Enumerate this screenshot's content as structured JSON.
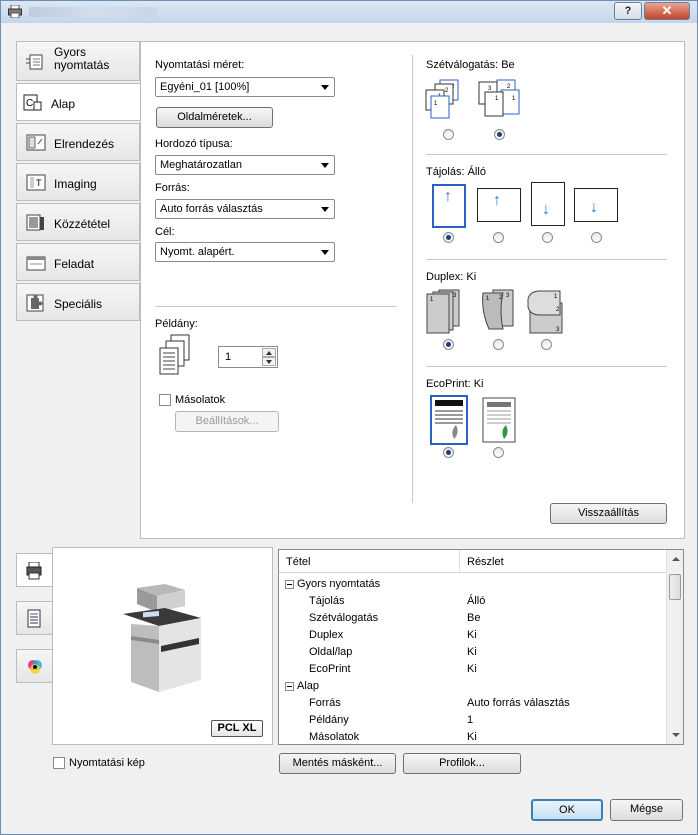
{
  "window": {
    "help": "?",
    "close": "✕"
  },
  "tabs": [
    {
      "label_line1": "Gyors",
      "label_line2": "nyomtatás"
    },
    {
      "label": "Alap"
    },
    {
      "label": "Elrendezés"
    },
    {
      "label": "Imaging"
    },
    {
      "label": "Közzététel"
    },
    {
      "label": "Feladat"
    },
    {
      "label": "Speciális"
    }
  ],
  "basic": {
    "print_size_label": "Nyomtatási méret:",
    "print_size_value": "Egyéni_01 [100%]",
    "page_sizes_button": "Oldalméretek...",
    "media_type_label": "Hordozó típusa:",
    "media_type_value": "Meghatározatlan",
    "source_label": "Forrás:",
    "source_value": "Auto forrás választás",
    "destination_label": "Cél:",
    "destination_value": "Nyomt. alapért.",
    "copies_label": "Példány:",
    "copies_value": "1",
    "copies_checkbox_label": "Másolatok",
    "settings_button": "Beállítások..."
  },
  "collate": {
    "label": "Szétválogatás:",
    "value": "Be",
    "selected": 1
  },
  "orientation": {
    "label": "Tájolás:",
    "value": "Álló",
    "selected": 0
  },
  "duplex": {
    "label": "Duplex:",
    "value": "Ki",
    "selected": 0
  },
  "ecoprint": {
    "label": "EcoPrint:",
    "value": "Ki",
    "selected": 0
  },
  "reset_button": "Visszaállítás",
  "preview": {
    "badge": "PCL XL",
    "print_preview_label": "Nyomtatási kép"
  },
  "summary": {
    "col_item": "Tétel",
    "col_detail": "Részlet",
    "rows": [
      {
        "item": "Gyors nyomtatás",
        "detail": "",
        "group": true
      },
      {
        "item": "Tájolás",
        "detail": "Álló"
      },
      {
        "item": "Szétválogatás",
        "detail": "Be"
      },
      {
        "item": "Duplex",
        "detail": "Ki"
      },
      {
        "item": "Oldal/lap",
        "detail": "Ki"
      },
      {
        "item": "EcoPrint",
        "detail": "Ki"
      },
      {
        "item": "Alap",
        "detail": "",
        "group": true
      },
      {
        "item": "Forrás",
        "detail": "Auto forrás választás"
      },
      {
        "item": "Példány",
        "detail": "1"
      },
      {
        "item": "Másolatok",
        "detail": "Ki"
      }
    ]
  },
  "footer": {
    "save_as": "Mentés másként...",
    "profiles": "Profilok...",
    "ok": "OK",
    "cancel": "Mégse"
  }
}
